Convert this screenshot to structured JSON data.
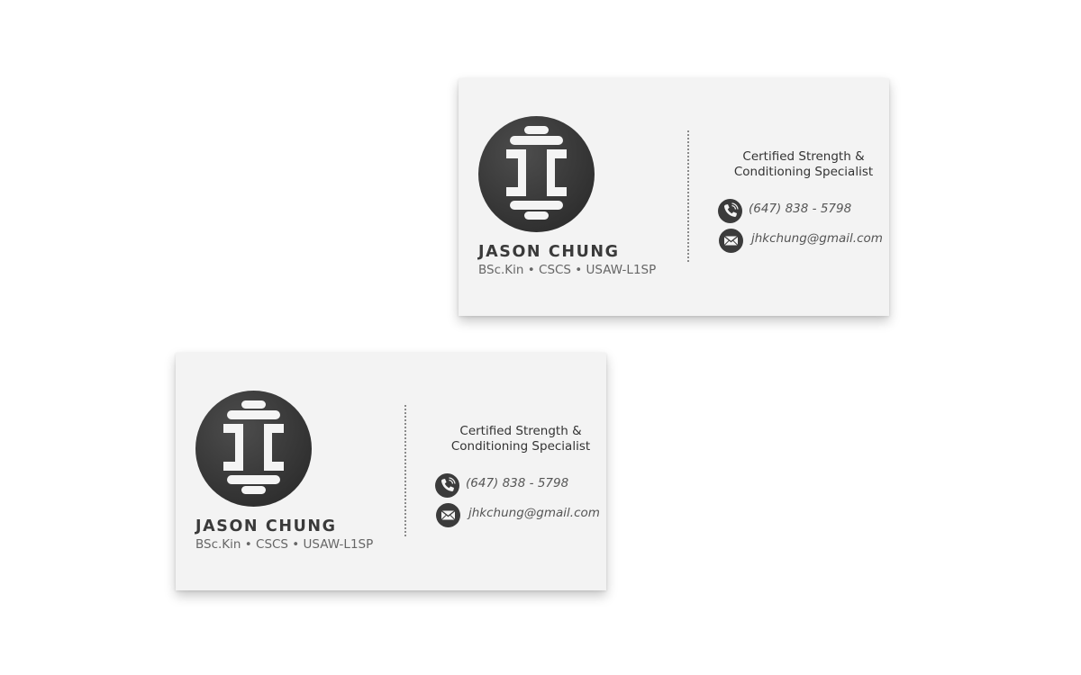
{
  "cards": [
    {
      "name": "JASON CHUNG",
      "credentials": "BSc.Kin • CSCS • USAW-L1SP",
      "title_line1": "Certified Strength &",
      "title_line2": "Conditioning Specialist",
      "phone": "(647) 838 - 5798",
      "email": "jhkchung@gmail.com",
      "logo_icon": "jc-barbell-monogram",
      "phone_icon": "phone-icon",
      "email_icon": "envelope-icon"
    },
    {
      "name": "JASON CHUNG",
      "credentials": "BSc.Kin • CSCS • USAW-L1SP",
      "title_line1": "Certified Strength &",
      "title_line2": "Conditioning Specialist",
      "phone": "(647) 838 - 5798",
      "email": "jhkchung@gmail.com",
      "logo_icon": "jc-barbell-monogram",
      "phone_icon": "phone-icon",
      "email_icon": "envelope-icon"
    }
  ],
  "colors": {
    "card_background": "#f3f3f3",
    "logo_circle": "#3b3b3b",
    "name_text": "#3a3a3a",
    "secondary_text": "#666666"
  }
}
